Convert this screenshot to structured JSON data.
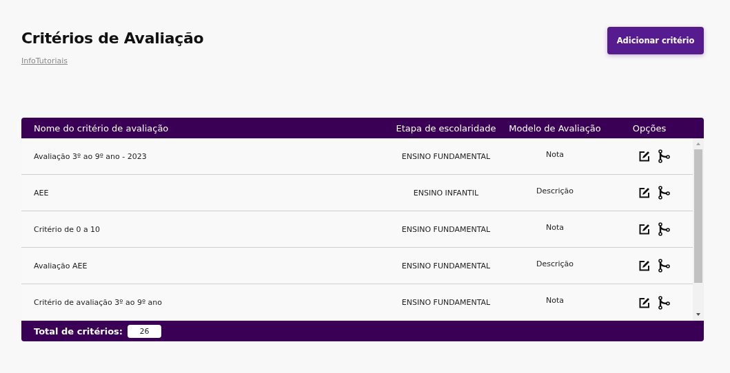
{
  "page": {
    "title": "Critérios de Avaliação",
    "link": "InfoTutoriais",
    "add_button": "Adicionar critério"
  },
  "table": {
    "columns": [
      "Nome do critério de avaliação",
      "Etapa de escolaridade",
      "Modelo de Avaliação",
      "Opções"
    ],
    "rows": [
      {
        "name": "Avaliação 3º ao 9º ano - 2023",
        "stage": "ENSINO FUNDAMENTAL",
        "model": "Nota"
      },
      {
        "name": "AEE",
        "stage": "ENSINO INFANTIL",
        "model": "Descrição"
      },
      {
        "name": "Critério de 0 a 10",
        "stage": "ENSINO FUNDAMENTAL",
        "model": "Nota"
      },
      {
        "name": "Avaliação AEE",
        "stage": "ENSINO FUNDAMENTAL",
        "model": "Descrição"
      },
      {
        "name": "Critério de avaliação 3º ao 9º ano",
        "stage": "ENSINO FUNDAMENTAL",
        "model": "Nota"
      }
    ]
  },
  "footer": {
    "label": "Total de critérios:",
    "total": "26"
  }
}
